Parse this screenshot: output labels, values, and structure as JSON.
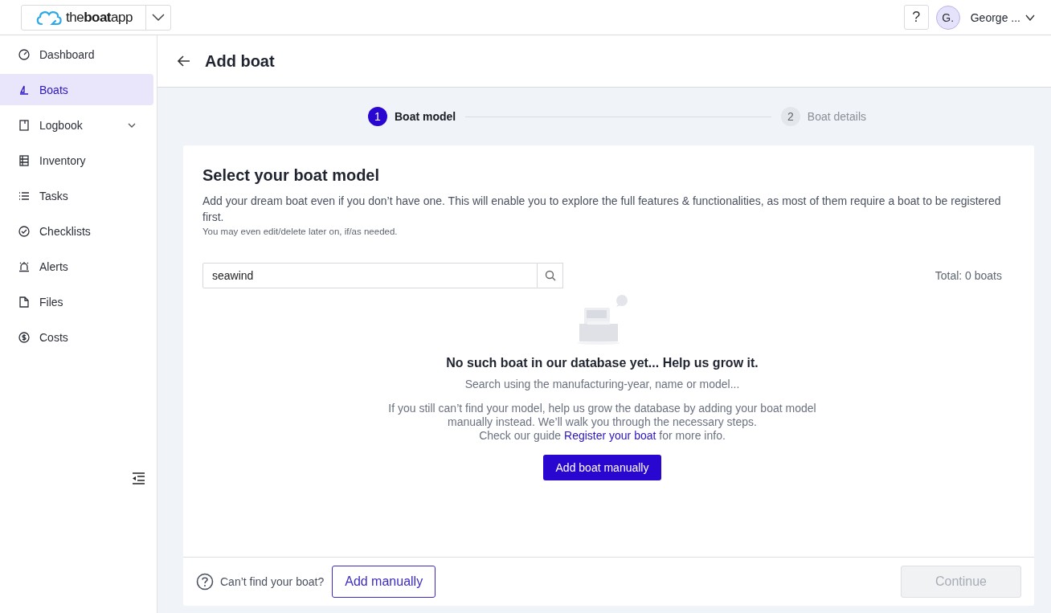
{
  "topbar": {
    "logo": "the**boat**app",
    "help": "?",
    "avatar": "G.",
    "user": "George ..."
  },
  "sidebar": {
    "items": [
      {
        "label": "Dashboard",
        "selected": false,
        "kind": "link"
      },
      {
        "label": "Boats",
        "selected": true,
        "kind": "link"
      },
      {
        "label": "Logbook",
        "selected": false,
        "kind": "group",
        "expanded": false
      },
      {
        "label": "Inventory",
        "selected": false,
        "kind": "link"
      },
      {
        "label": "Tasks",
        "selected": false,
        "kind": "link"
      },
      {
        "label": "Checklists",
        "selected": false,
        "kind": "link"
      },
      {
        "label": "Alerts",
        "selected": false,
        "kind": "link"
      },
      {
        "label": "Files",
        "selected": false,
        "kind": "link"
      },
      {
        "label": "Costs",
        "selected": false,
        "kind": "link"
      }
    ]
  },
  "page": {
    "title": "Add boat"
  },
  "steps": [
    {
      "number": "1",
      "label": "Boat model",
      "selected": true
    },
    {
      "number": "2",
      "label": "Boat details",
      "selected": false
    }
  ],
  "card": {
    "title": "Select your boat model",
    "intro": "Add your dream boat even if you don’t have one. This will enable you to explore the full features & functionalities, as most of them require a boat to be registered first.",
    "note": "You may even edit/delete later on, if/as needed.",
    "search": {
      "value": "seawind"
    },
    "total": "Total: 0 boats",
    "empty": {
      "title": "No such boat in our database yet... Help us grow it.",
      "hint": "Search using the manufacturing-year, name or model...",
      "text": "If you still can’t find your model, help us grow the database by adding your boat model manually instead. We’ll walk you through the necessary steps.",
      "guide_before": "Check our guide",
      "guide_link": "Register your boat",
      "guide_after": "for more info.",
      "button": "Add boat manually"
    },
    "footer": {
      "question": "Can’t find your boat?",
      "add": "Add manually",
      "continue": "Continue",
      "continue_disabled": true
    }
  }
}
